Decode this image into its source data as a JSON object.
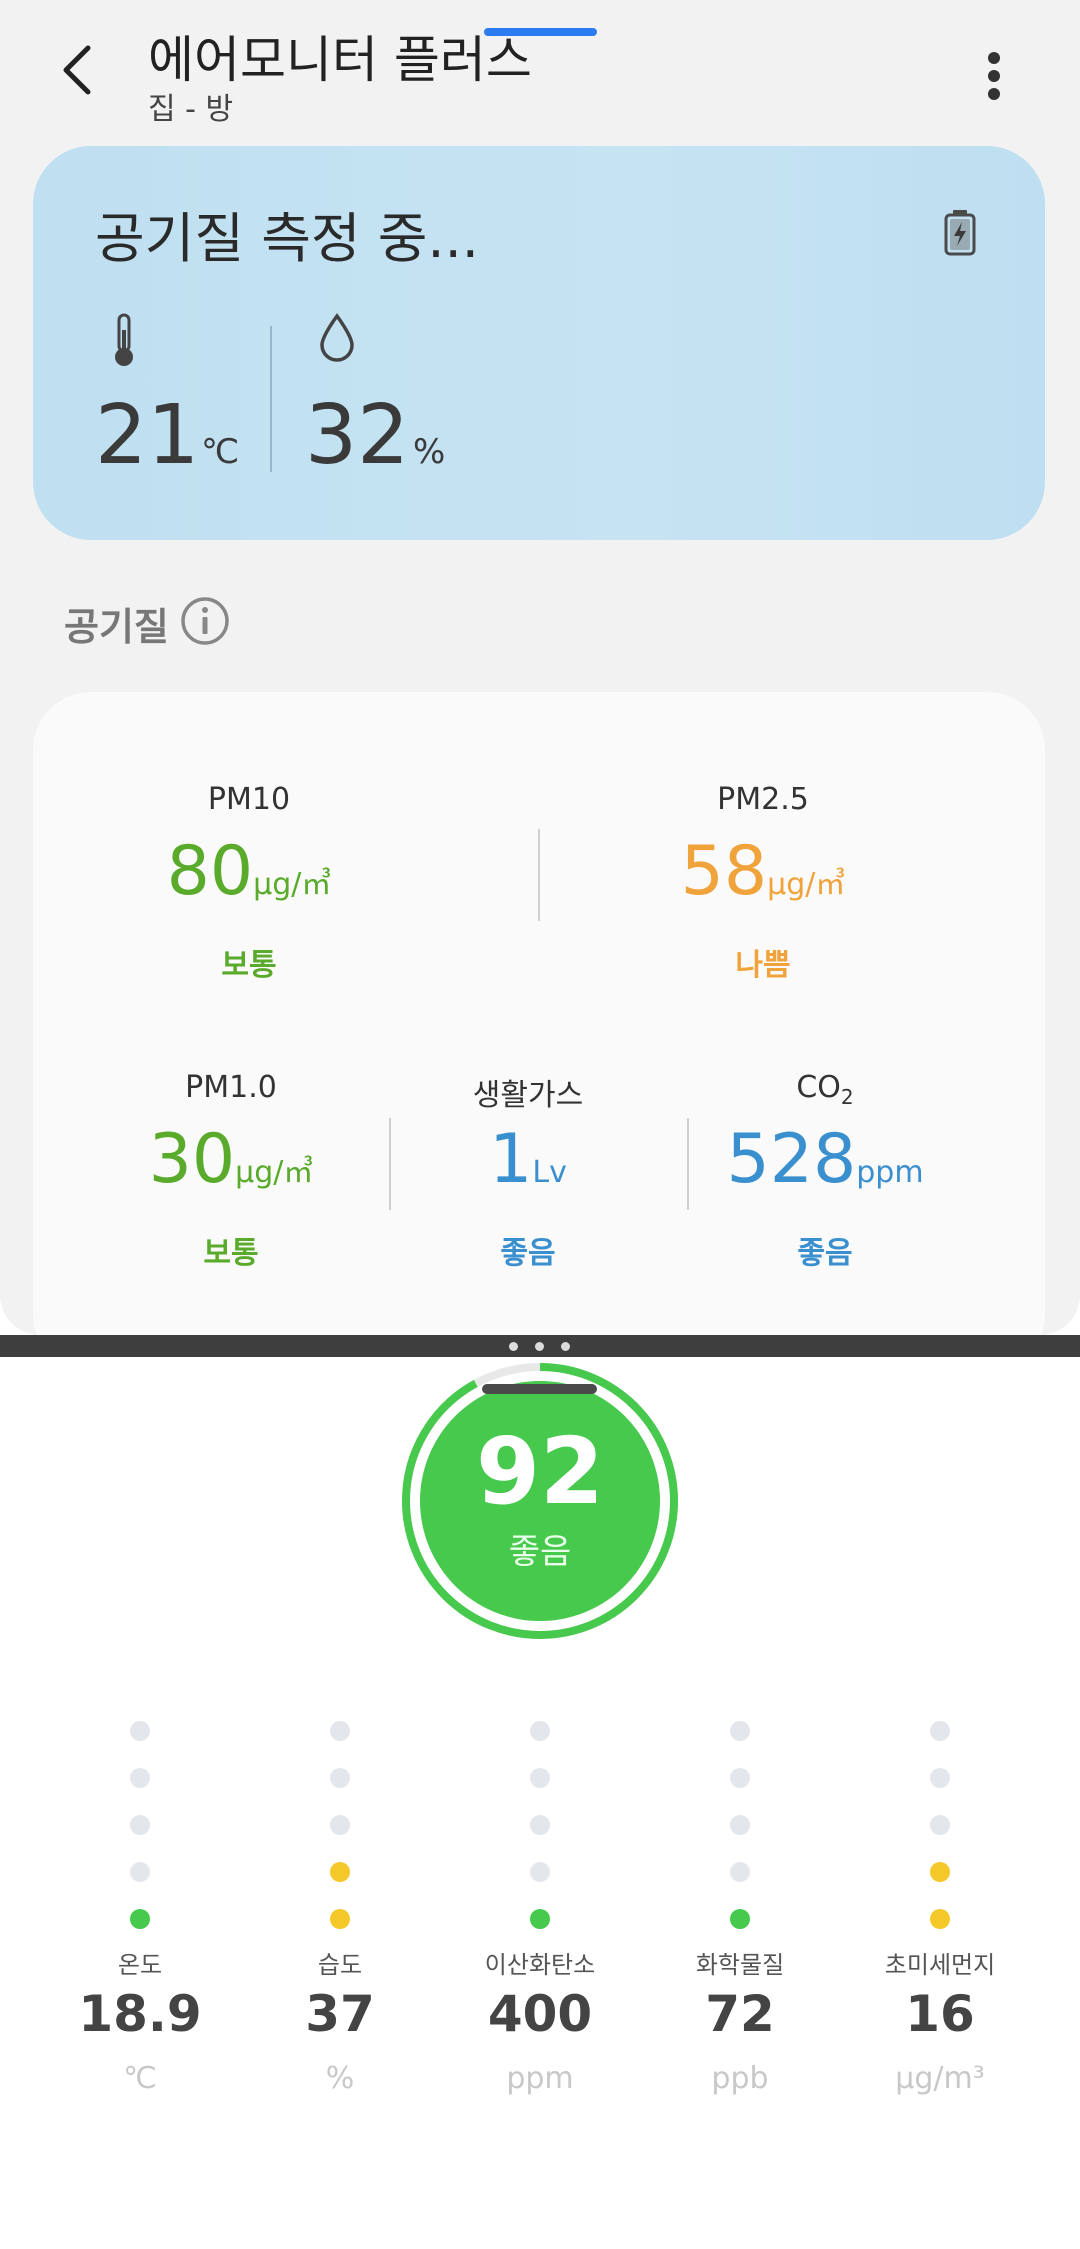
{
  "header": {
    "title": "에어모니터 플러스",
    "subtitle": "집 - 방"
  },
  "status_card": {
    "status_text": "공기질 측정 중...",
    "temperature": "21",
    "temperature_unit": "℃",
    "humidity": "32",
    "humidity_unit": "%",
    "icons": [
      "thermometer-icon",
      "water-drop-icon",
      "battery-charging-icon"
    ]
  },
  "air_quality": {
    "section_title": "공기질",
    "metrics": [
      {
        "label": "PM10",
        "value": "80",
        "unit": "μg/㎥",
        "status": "보통",
        "color": "#5aaa2c"
      },
      {
        "label": "PM2.5",
        "value": "58",
        "unit": "μg/㎥",
        "status": "나쁨",
        "color": "#f0a33a"
      },
      {
        "label": "PM1.0",
        "value": "30",
        "unit": "μg/㎥",
        "status": "보통",
        "color": "#5aaa2c"
      },
      {
        "label": "생활가스",
        "value": "1",
        "unit": "Lv",
        "status": "좋음",
        "color": "#3a8fcf"
      },
      {
        "label": "CO",
        "label_sub": "2",
        "value": "528",
        "unit": "ppm",
        "status": "좋음",
        "color": "#3a8fcf"
      }
    ]
  },
  "score": {
    "value": "92",
    "label": "좋음",
    "fraction": 0.92,
    "color": "#46c94c"
  },
  "sensors": [
    {
      "name": "온도",
      "value": "18.9",
      "unit": "℃",
      "level": 1,
      "level_color": "#46c94c"
    },
    {
      "name": "습도",
      "value": "37",
      "unit": "%",
      "level": 2,
      "level_color": "#f5c82a"
    },
    {
      "name": "이산화탄소",
      "value": "400",
      "unit": "ppm",
      "level": 1,
      "level_color": "#46c94c"
    },
    {
      "name": "화학물질",
      "value": "72",
      "unit": "ppb",
      "level": 1,
      "level_color": "#46c94c"
    },
    {
      "name": "초미세먼지",
      "value": "16",
      "unit": "μg/m³",
      "level": 2,
      "level_color": "#f5c82a"
    }
  ],
  "colors": {
    "level_good": "#46c94c",
    "level_moderate": "#f5c82a",
    "level_empty": "#e3e6ea"
  }
}
